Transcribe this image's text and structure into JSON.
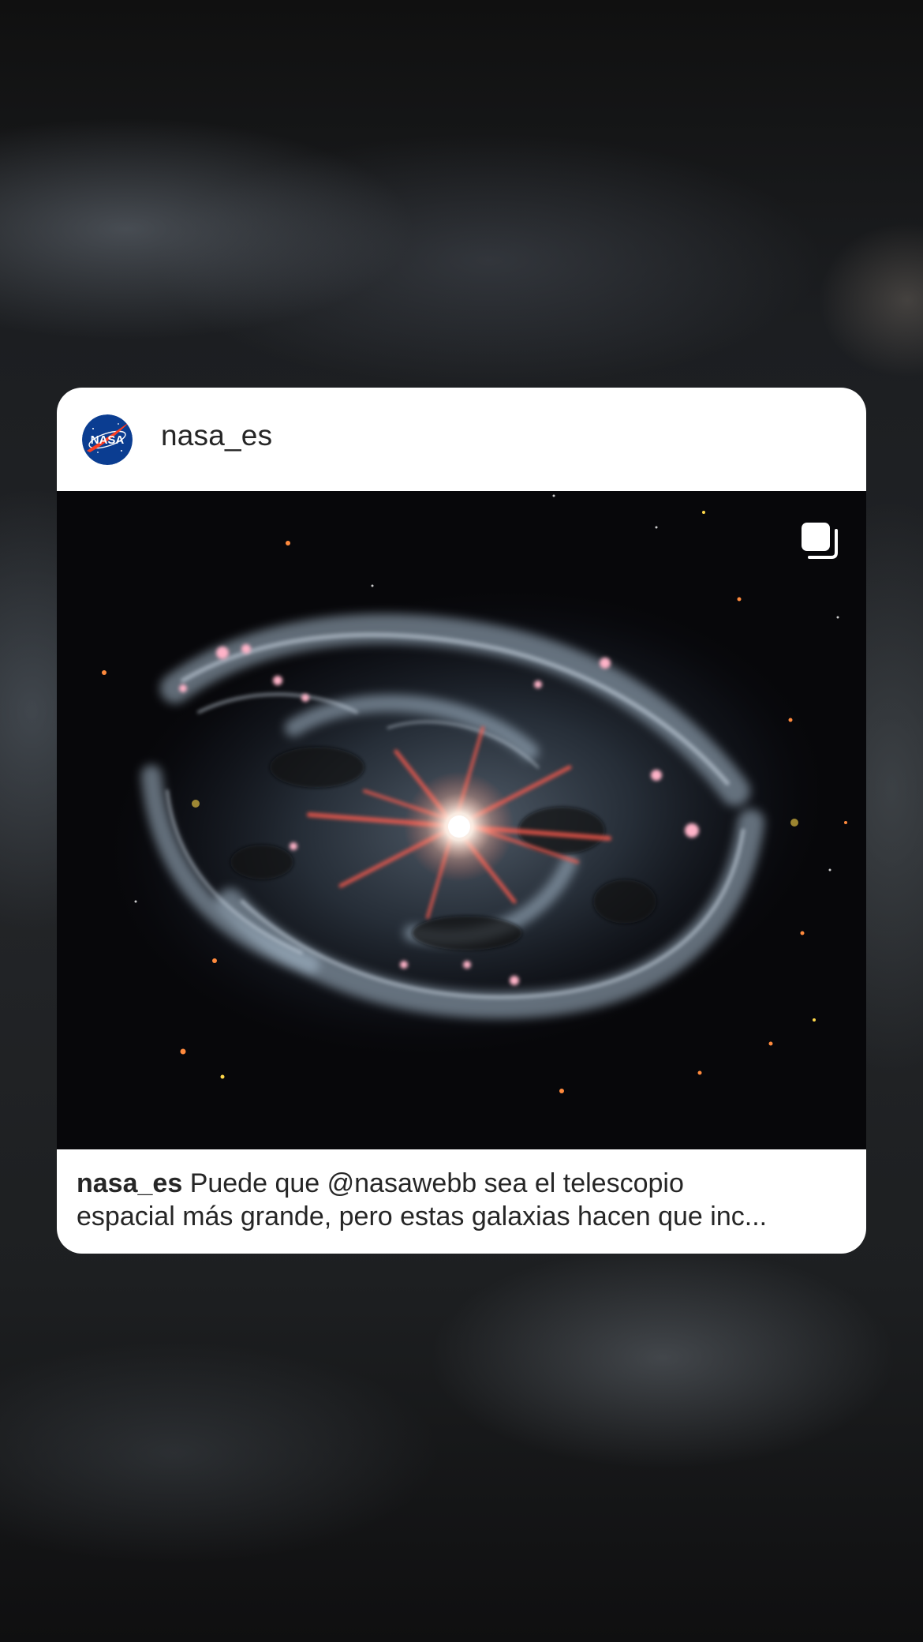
{
  "post": {
    "username": "nasa_es",
    "avatar_text": "NASA",
    "media_icon": "multiple-images-icon",
    "caption": {
      "username": "nasa_es",
      "line1": "Puede que @nasawebb sea el telescopio",
      "line2": "espacial más grande, pero estas galaxias hacen que inc..."
    }
  },
  "colors": {
    "card_background": "#ffffff",
    "text": "#262626",
    "nasa_blue": "#0b3d91",
    "nasa_red": "#fc3d21"
  }
}
